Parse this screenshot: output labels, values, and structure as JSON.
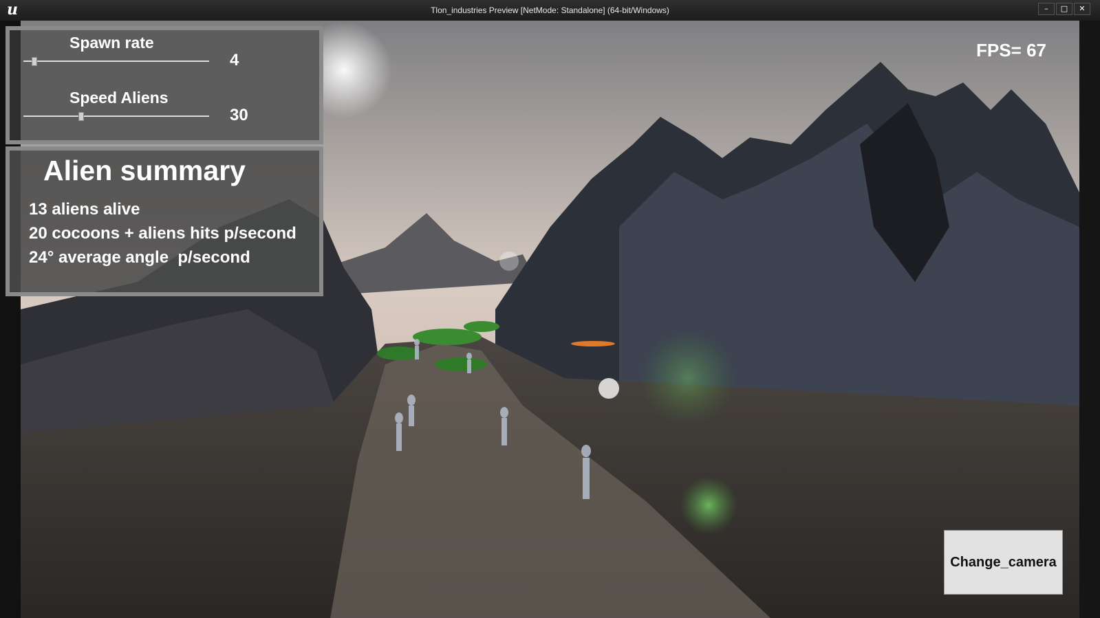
{
  "window": {
    "title": "Tlon_industries Preview [NetMode: Standalone]  (64-bit/Windows)",
    "logo_icon": "unreal-engine-logo-icon",
    "minimize_icon": "minimize-icon",
    "maximize_icon": "maximize-icon",
    "close_icon": "close-icon"
  },
  "hud": {
    "fps": "FPS= 67"
  },
  "controls": {
    "spawn_rate": {
      "label": "Spawn rate",
      "value": "4",
      "fraction": 0.05
    },
    "speed_aliens": {
      "label": "Speed Aliens",
      "value": "30",
      "fraction": 0.3
    }
  },
  "summary": {
    "title": "Alien summary",
    "lines": [
      "13 aliens alive",
      "20 cocoons + aliens hits p/second",
      "24° average angle  p/second"
    ]
  },
  "buttons": {
    "change_camera": "Change_camera"
  }
}
